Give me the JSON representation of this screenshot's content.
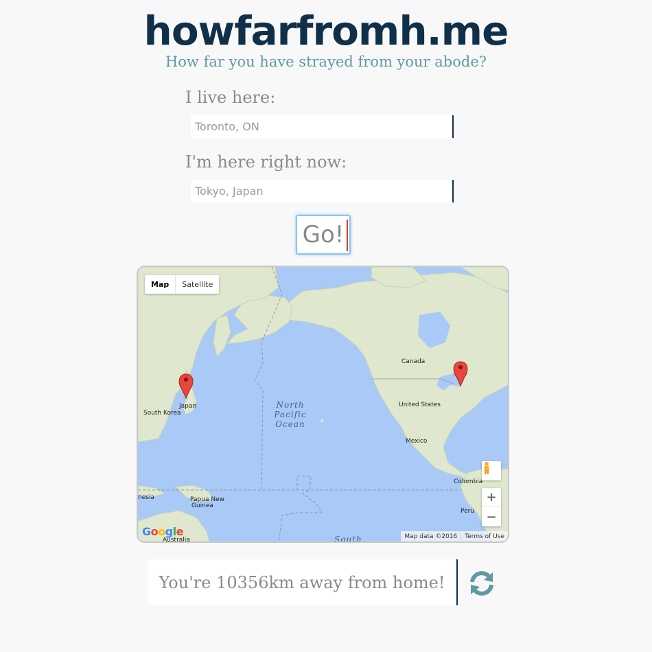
{
  "header": {
    "title": "howfarfromh.me",
    "tagline": "How far you have strayed from your abode?"
  },
  "form": {
    "home_label": "I live here:",
    "home_placeholder": "Toronto, ON",
    "current_label": "I'm here right now:",
    "current_placeholder": "Tokyo, Japan",
    "go_label": "Go!"
  },
  "map": {
    "map_type": [
      "Map",
      "Satellite"
    ],
    "labels": {
      "canada": "Canada",
      "united_states": "United States",
      "mexico": "Mexico",
      "colombia": "Colombia",
      "peru": "Peru",
      "japan": "Japan",
      "south_korea": "South Korea",
      "papua_new_guinea_1": "Papua New",
      "papua_new_guinea_2": "Guinea",
      "nesia": "nesia",
      "australia": "Australia",
      "ocean_1": "North",
      "ocean_2": "Pacific",
      "ocean_3": "Ocean",
      "south": "South"
    },
    "zoom_in": "+",
    "zoom_out": "−",
    "logo": "Google",
    "attribution": "Map data ©2016",
    "terms": "Terms of Use",
    "pegman_icon": "pegman-icon",
    "marker_icon": "map-marker-icon"
  },
  "result": {
    "text": "You're 10356km away from home!",
    "refresh_icon": "refresh-icon",
    "accent": "#5f9aa2"
  },
  "colors": {
    "title": "#10304a",
    "tagline": "#5f9aa2",
    "label": "#8a8a8a",
    "water": "#a9c9f6",
    "land": "#dfe8cf"
  }
}
